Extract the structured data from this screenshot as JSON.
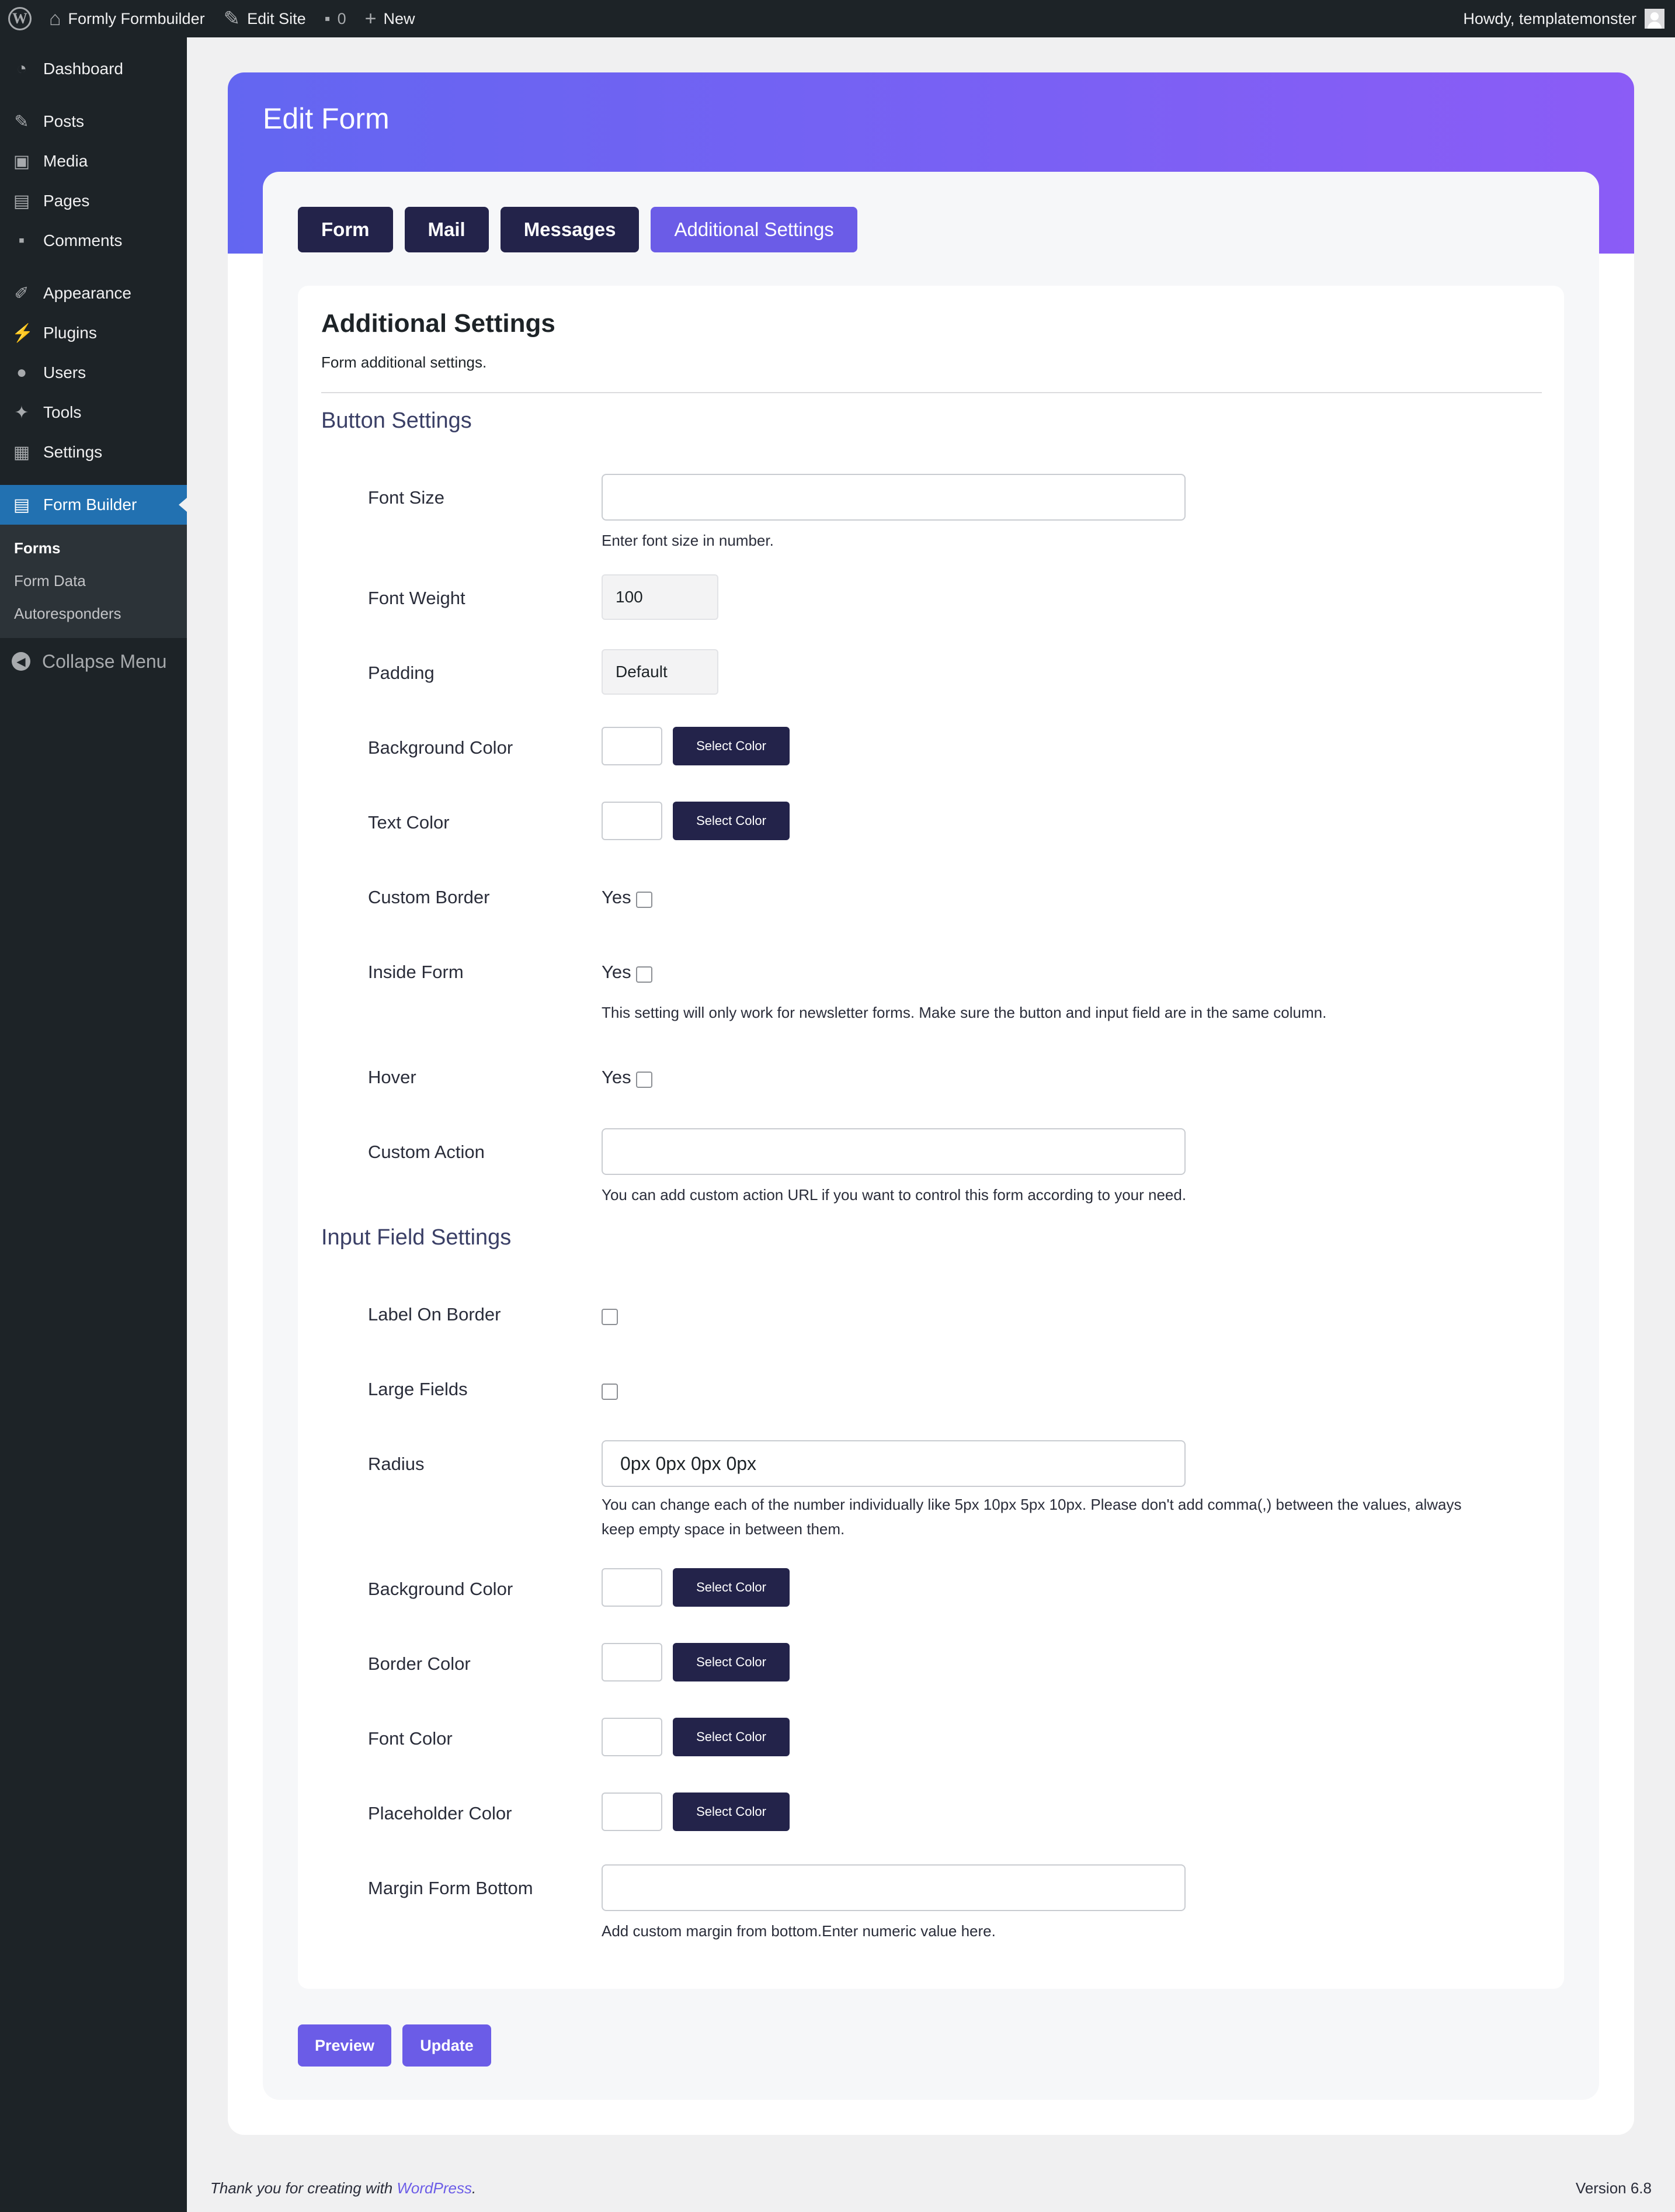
{
  "adminbar": {
    "site_name": "Formly Formbuilder",
    "edit_site": "Edit Site",
    "comments_count": "0",
    "new_label": "New",
    "howdy": "Howdy, templatemonster"
  },
  "sidebar": {
    "items": [
      {
        "label": "Dashboard",
        "icon": "dashboard-icon"
      },
      {
        "label": "Posts",
        "icon": "pin-icon"
      },
      {
        "label": "Media",
        "icon": "media-icon"
      },
      {
        "label": "Pages",
        "icon": "pages-icon"
      },
      {
        "label": "Comments",
        "icon": "comments-icon"
      },
      {
        "label": "Appearance",
        "icon": "brush-icon"
      },
      {
        "label": "Plugins",
        "icon": "plugin-icon"
      },
      {
        "label": "Users",
        "icon": "users-icon"
      },
      {
        "label": "Tools",
        "icon": "wrench-icon"
      },
      {
        "label": "Settings",
        "icon": "settings-icon"
      },
      {
        "label": "Form Builder",
        "icon": "form-icon"
      }
    ],
    "submenu": [
      "Forms",
      "Form Data",
      "Autoresponders"
    ],
    "collapse": "Collapse Menu"
  },
  "page": {
    "title": "Edit Form",
    "tabs": [
      "Form",
      "Mail",
      "Messages",
      "Additional Settings"
    ],
    "active_tab": "Additional Settings"
  },
  "panel": {
    "title": "Additional Settings",
    "subtitle": "Form additional settings.",
    "button_section": "Button Settings",
    "input_section": "Input Field Settings",
    "select_color": "Select Color",
    "yes": "Yes"
  },
  "button_settings": {
    "font_size_label": "Font Size",
    "font_size_value": "",
    "font_size_help": "Enter font size in number.",
    "font_weight_label": "Font Weight",
    "font_weight_value": "100",
    "padding_label": "Padding",
    "padding_value": "Default",
    "bg_color_label": "Background Color",
    "text_color_label": "Text Color",
    "custom_border_label": "Custom Border",
    "inside_form_label": "Inside Form",
    "inside_form_help": "This setting will only work for newsletter forms. Make sure the button and input field are in the same column.",
    "hover_label": "Hover",
    "custom_action_label": "Custom Action",
    "custom_action_value": "",
    "custom_action_help": "You can add custom action URL if you want to control this form according to your need."
  },
  "input_settings": {
    "label_on_border_label": "Label On Border",
    "large_fields_label": "Large Fields",
    "radius_label": "Radius",
    "radius_value": "0px 0px 0px 0px",
    "radius_help_1": "You can change each of the number individually like 5px 10px 5px 10px. Please don't add comma(,) between the values, always",
    "radius_help_2": "keep empty space in between them.",
    "bg_color_label": "Background Color",
    "border_color_label": "Border Color",
    "font_color_label": "Font Color",
    "placeholder_color_label": "Placeholder Color",
    "margin_bottom_label": "Margin Form Bottom",
    "margin_bottom_value": "",
    "margin_bottom_help": "Add custom margin from bottom.Enter numeric value here."
  },
  "actions": {
    "preview": "Preview",
    "update": "Update"
  },
  "footer": {
    "thanks_prefix": "Thank you for creating with ",
    "wp_link": "WordPress",
    "thanks_suffix": ".",
    "version": "Version 6.8"
  },
  "colors": {
    "accent": "#6b5ce7",
    "dark_button": "#23234a",
    "hero_start": "#6366f1",
    "hero_end": "#8b5cf6",
    "wp_admin_dark": "#1d2327",
    "wp_blue": "#2271b1"
  }
}
